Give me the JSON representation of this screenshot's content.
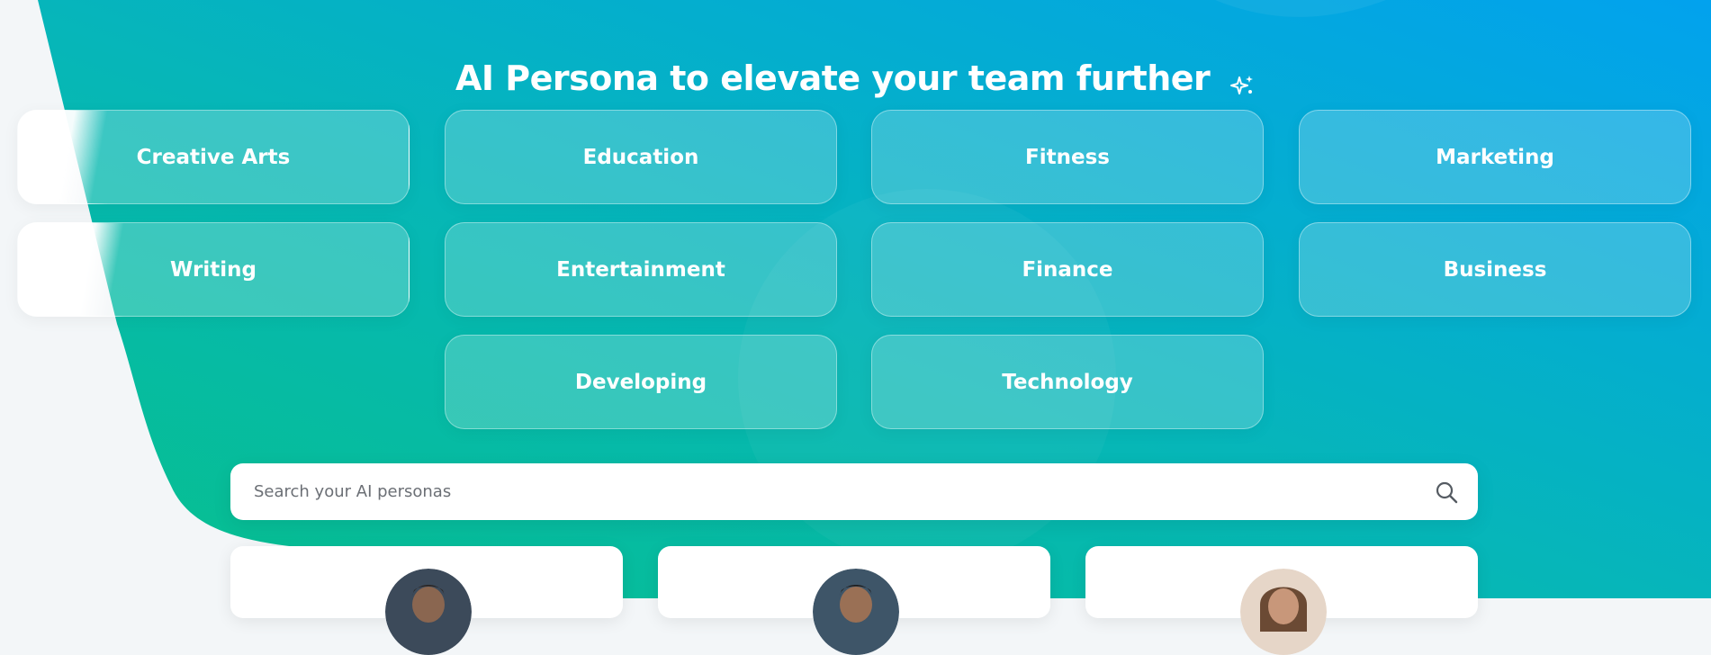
{
  "header": {
    "title": "AI Persona to elevate your team further",
    "title_icon": "sparkle-icon"
  },
  "categories": [
    {
      "label": "Creative Arts"
    },
    {
      "label": "Education"
    },
    {
      "label": "Fitness"
    },
    {
      "label": "Marketing"
    },
    {
      "label": "Writing"
    },
    {
      "label": "Entertainment"
    },
    {
      "label": "Finance"
    },
    {
      "label": "Business"
    },
    {
      "label": "Developing"
    },
    {
      "label": "Technology"
    }
  ],
  "search": {
    "placeholder": "Search your AI personas",
    "value": "",
    "icon": "search-icon"
  },
  "colors": {
    "gradient_start": "#0bbf95",
    "gradient_end": "#03a3ea",
    "text": "#ffffff"
  }
}
